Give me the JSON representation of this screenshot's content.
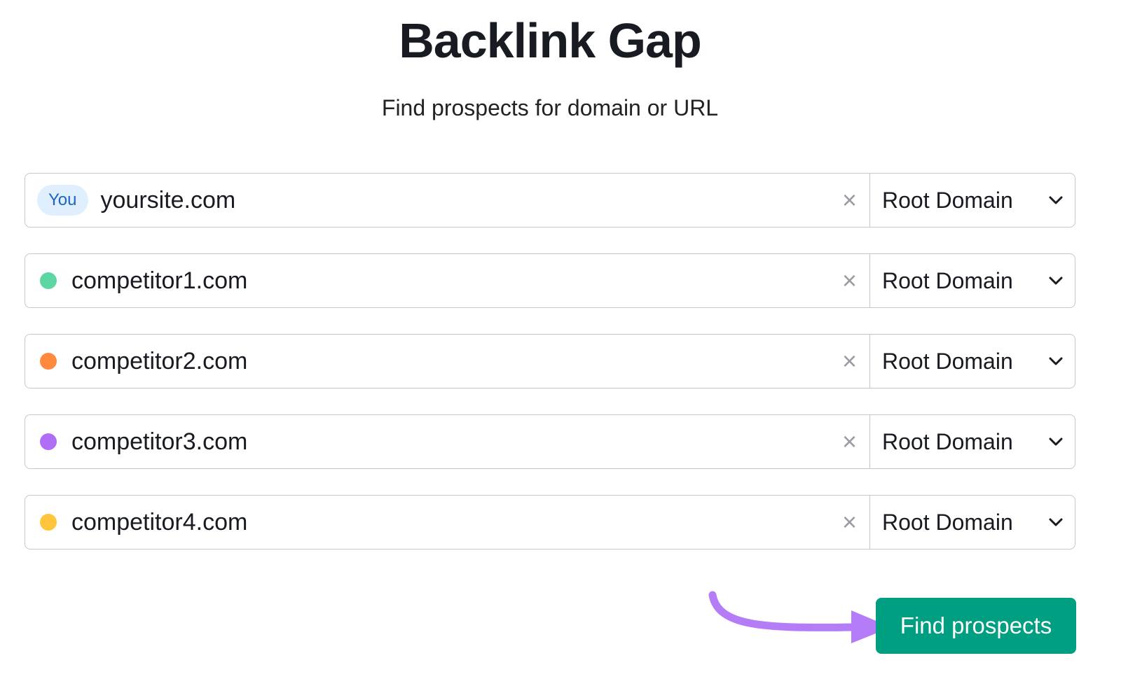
{
  "header": {
    "title": "Backlink Gap",
    "subtitle": "Find prospects for domain or URL"
  },
  "rows": [
    {
      "badge": "You",
      "value": "yoursite.com",
      "scope": "Root Domain"
    },
    {
      "value": "competitor1.com",
      "color": "#5ed6a4",
      "scope": "Root Domain"
    },
    {
      "value": "competitor2.com",
      "color": "#ff8a3d",
      "scope": "Root Domain"
    },
    {
      "value": "competitor3.com",
      "color": "#b06ef7",
      "scope": "Root Domain"
    },
    {
      "value": "competitor4.com",
      "color": "#ffc53d",
      "scope": "Root Domain"
    }
  ],
  "clear_icon": "×",
  "button": {
    "label": "Find prospects",
    "color": "#009f81"
  },
  "arrow_color": "#b57cf7"
}
